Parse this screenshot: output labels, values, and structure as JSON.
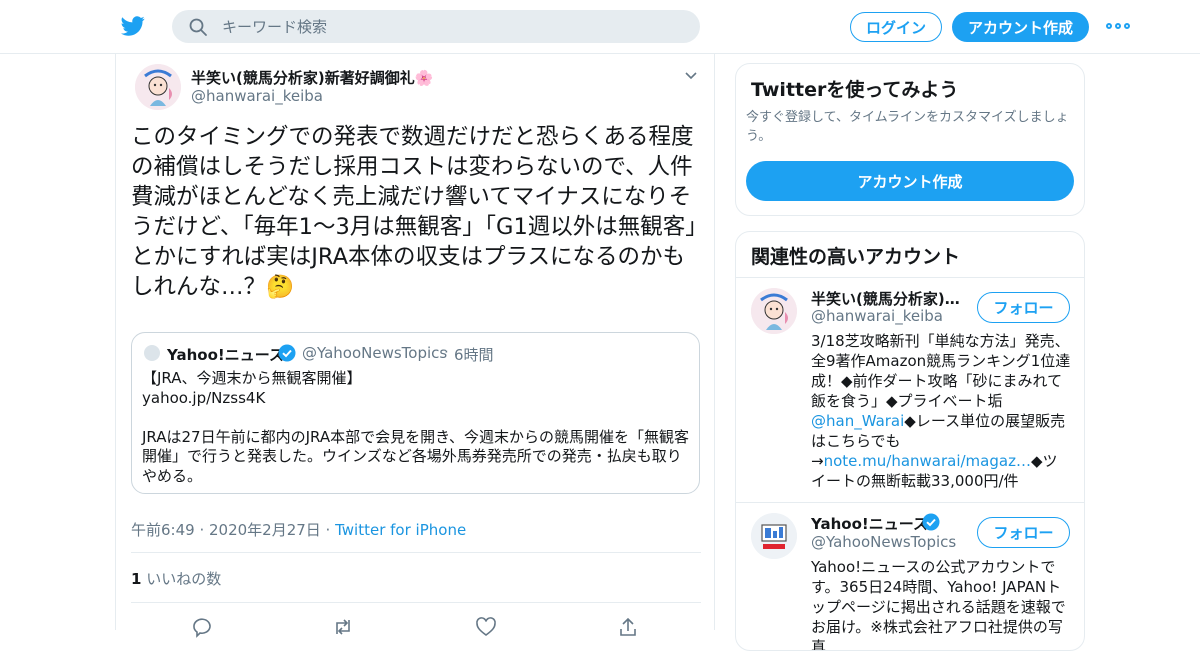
{
  "header": {
    "search_placeholder": "キーワード検索",
    "login_label": "ログイン",
    "signup_label": "アカウント作成",
    "accent_color": "#1da1f2"
  },
  "tweet": {
    "display_name": "半笑い(競馬分析家)新著好調御礼🌸",
    "handle": "@hanwarai_keiba",
    "text": "このタイミングでの発表で数週だけだと恐らくある程度の補償はしそうだし採用コストは変わらないので、人件費減がほとんどなく売上減だけ響いてマイナスになりそうだけど、「毎年1〜3月は無観客」「G1週以外は無観客」とかにすれば実はJRA本体の収支はプラスになるのかもしれんな…？🤔",
    "quote": {
      "name": "Yahoo!ニュース",
      "handle": "@YahooNewsTopics",
      "dot": "·",
      "time": "6時間",
      "text": "【JRA、今週末から無観客開催】\nyahoo.jp/Nzss4K\n\nJRAは27日午前に都内のJRA本部で会見を開き、今週末からの競馬開催を「無観客開催」で行うと発表した。ウインズなど各場外馬券発売所での発売・払戻も取りやめる。"
    },
    "timestamp": "午前6:49 · 2020年2月27日 · ",
    "source": "Twitter for iPhone",
    "likes_count": "1",
    "likes_label": " いいねの数"
  },
  "sidebar": {
    "try_title": "Twitterを使ってみよう",
    "try_desc": "今すぐ登録して、タイムラインをカスタマイズしましょう。",
    "try_button": "アカウント作成",
    "related_title": "関連性の高いアカウント",
    "follow_label": "フォロー",
    "accounts": [
      {
        "name": "半笑い(競馬分析家)…",
        "handle": "@hanwarai_keiba",
        "bio_1": "3/18芝攻略新刊「単純な方法」発売、全9著作Amazon競馬ランキング1位達成！◆前作ダート攻略「砂にまみれて飯を食う」◆プライベート垢",
        "bio_link_1": "@han_Warai",
        "bio_2": "◆レース単位の展望販売はこちらでも→",
        "bio_link_2": "note.mu/hanwarai/magaz…",
        "bio_3": "◆ツイートの無断転載33,000円/件"
      },
      {
        "name": "Yahoo!ニュース",
        "handle": "@YahooNewsTopics",
        "bio": "Yahoo!ニュースの公式アカウントです。365日24時間、Yahoo! JAPANトップページに掲出される話題を速報でお届け。※株式会社アフロ社提供の写真"
      }
    ]
  }
}
